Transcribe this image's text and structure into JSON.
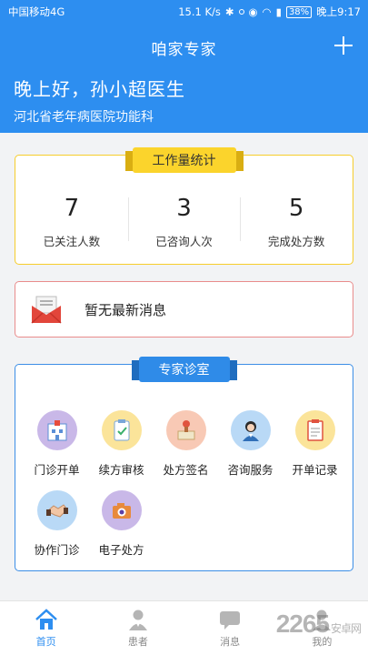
{
  "status_bar": {
    "carrier": "中国移动4G",
    "speed": "15.1 K/s",
    "battery": "38%",
    "time": "晚上9:17"
  },
  "header": {
    "title": "咱家专家",
    "greeting": "晚上好，孙小超医生",
    "hospital": "河北省老年病医院功能科"
  },
  "stats": {
    "title": "工作量统计",
    "items": [
      {
        "value": "7",
        "label": "已关注人数"
      },
      {
        "value": "3",
        "label": "已咨询人次"
      },
      {
        "value": "5",
        "label": "完成处方数"
      }
    ]
  },
  "message": {
    "text": "暂无最新消息",
    "icon": "mail-icon"
  },
  "clinic": {
    "title": "专家诊室",
    "items": [
      {
        "label": "门诊开单",
        "icon": "hospital-icon",
        "bg": "#c9b8e8"
      },
      {
        "label": "续方审核",
        "icon": "clipboard-check-icon",
        "bg": "#fbe49a"
      },
      {
        "label": "处方签名",
        "icon": "stamp-icon",
        "bg": "#f8c9b5"
      },
      {
        "label": "咨询服务",
        "icon": "nurse-icon",
        "bg": "#b9d9f6"
      },
      {
        "label": "开单记录",
        "icon": "record-list-icon",
        "bg": "#fbe49a"
      },
      {
        "label": "协作门诊",
        "icon": "handshake-icon",
        "bg": "#b9d9f6"
      },
      {
        "label": "电子处方",
        "icon": "camera-icon",
        "bg": "#c9b8e8"
      }
    ]
  },
  "tabs": [
    {
      "label": "首页",
      "icon": "home-icon",
      "active": true
    },
    {
      "label": "患者",
      "icon": "patient-icon",
      "active": false
    },
    {
      "label": "消息",
      "icon": "message-icon",
      "active": false
    },
    {
      "label": "我的",
      "icon": "profile-icon",
      "active": false
    }
  ],
  "watermark": {
    "text": "2265",
    "sub": "安卓网"
  },
  "colors": {
    "primary": "#2d8ef0",
    "stats_border": "#f6cd2c",
    "message_border": "#e98c8c",
    "clinic_border": "#3c8ee6"
  }
}
